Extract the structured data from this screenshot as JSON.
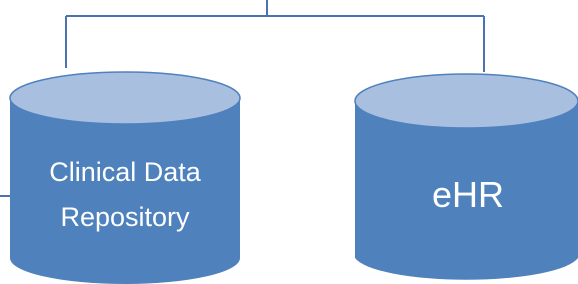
{
  "colors": {
    "connector": "#4a72b0",
    "cylinder_body": "#4f81bd",
    "cylinder_top": "#a8bfe0",
    "cylinder_rim": "#4f81bd",
    "label": "#ffffff"
  },
  "nodes": {
    "clinical_data_repository": {
      "label_line_1": "Clinical Data",
      "label_line_2": "Repository"
    },
    "ehr": {
      "label": "eHR"
    }
  }
}
